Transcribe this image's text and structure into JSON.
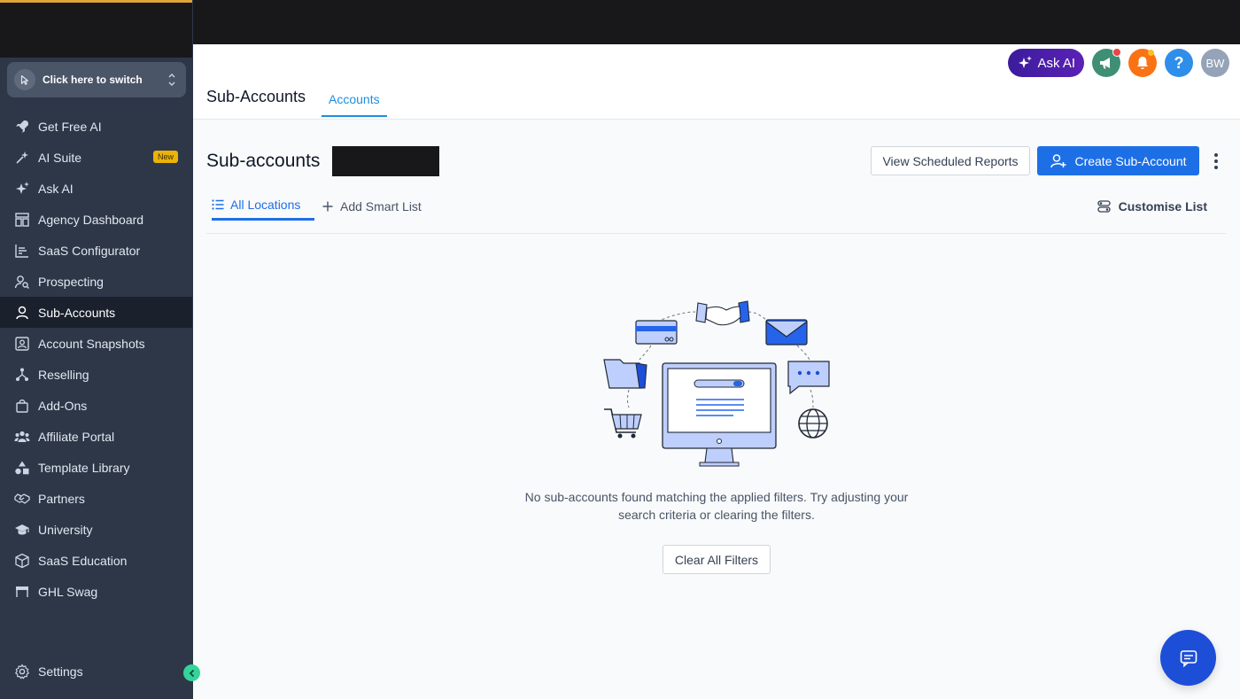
{
  "sidebar": {
    "switcher_label": "Click here to switch",
    "items": [
      {
        "label": "Get Free AI",
        "icon": "rocket-icon"
      },
      {
        "label": "AI Suite",
        "icon": "sparkle-wand-icon",
        "badge": "New"
      },
      {
        "label": "Ask AI",
        "icon": "sparkles-icon"
      },
      {
        "label": "Agency Dashboard",
        "icon": "dashboard-icon"
      },
      {
        "label": "SaaS Configurator",
        "icon": "bar-chart-icon"
      },
      {
        "label": "Prospecting",
        "icon": "user-search-icon"
      },
      {
        "label": "Sub-Accounts",
        "icon": "user-icon",
        "active": true
      },
      {
        "label": "Account Snapshots",
        "icon": "snapshot-icon"
      },
      {
        "label": "Reselling",
        "icon": "network-icon"
      },
      {
        "label": "Add-Ons",
        "icon": "shopping-bag-icon"
      },
      {
        "label": "Affiliate Portal",
        "icon": "users-icon"
      },
      {
        "label": "Template Library",
        "icon": "shapes-icon"
      },
      {
        "label": "Partners",
        "icon": "handshake-icon"
      },
      {
        "label": "University",
        "icon": "graduation-cap-icon"
      },
      {
        "label": "SaaS Education",
        "icon": "box-icon"
      },
      {
        "label": "GHL Swag",
        "icon": "store-icon"
      }
    ],
    "settings_label": "Settings"
  },
  "header": {
    "page_title": "Sub-Accounts",
    "tab_label": "Accounts",
    "ask_ai_label": "Ask AI",
    "avatar_initials": "BW",
    "help_label": "?"
  },
  "main": {
    "title": "Sub-accounts",
    "view_reports_label": "View Scheduled Reports",
    "create_label": "Create Sub-Account",
    "tab_all_locations": "All Locations",
    "tab_add_smart_list": "Add Smart List",
    "customise_list": "Customise List",
    "empty_message": "No sub-accounts found matching the applied filters. Try adjusting your search criteria or clearing the filters.",
    "clear_filters_label": "Clear All Filters"
  },
  "colors": {
    "sidebar_bg": "#2d3748",
    "active_item_bg": "#1a202c",
    "primary": "#1d6fe6",
    "tab_accent": "#1d8fe1",
    "badge_bg": "#eab308"
  }
}
